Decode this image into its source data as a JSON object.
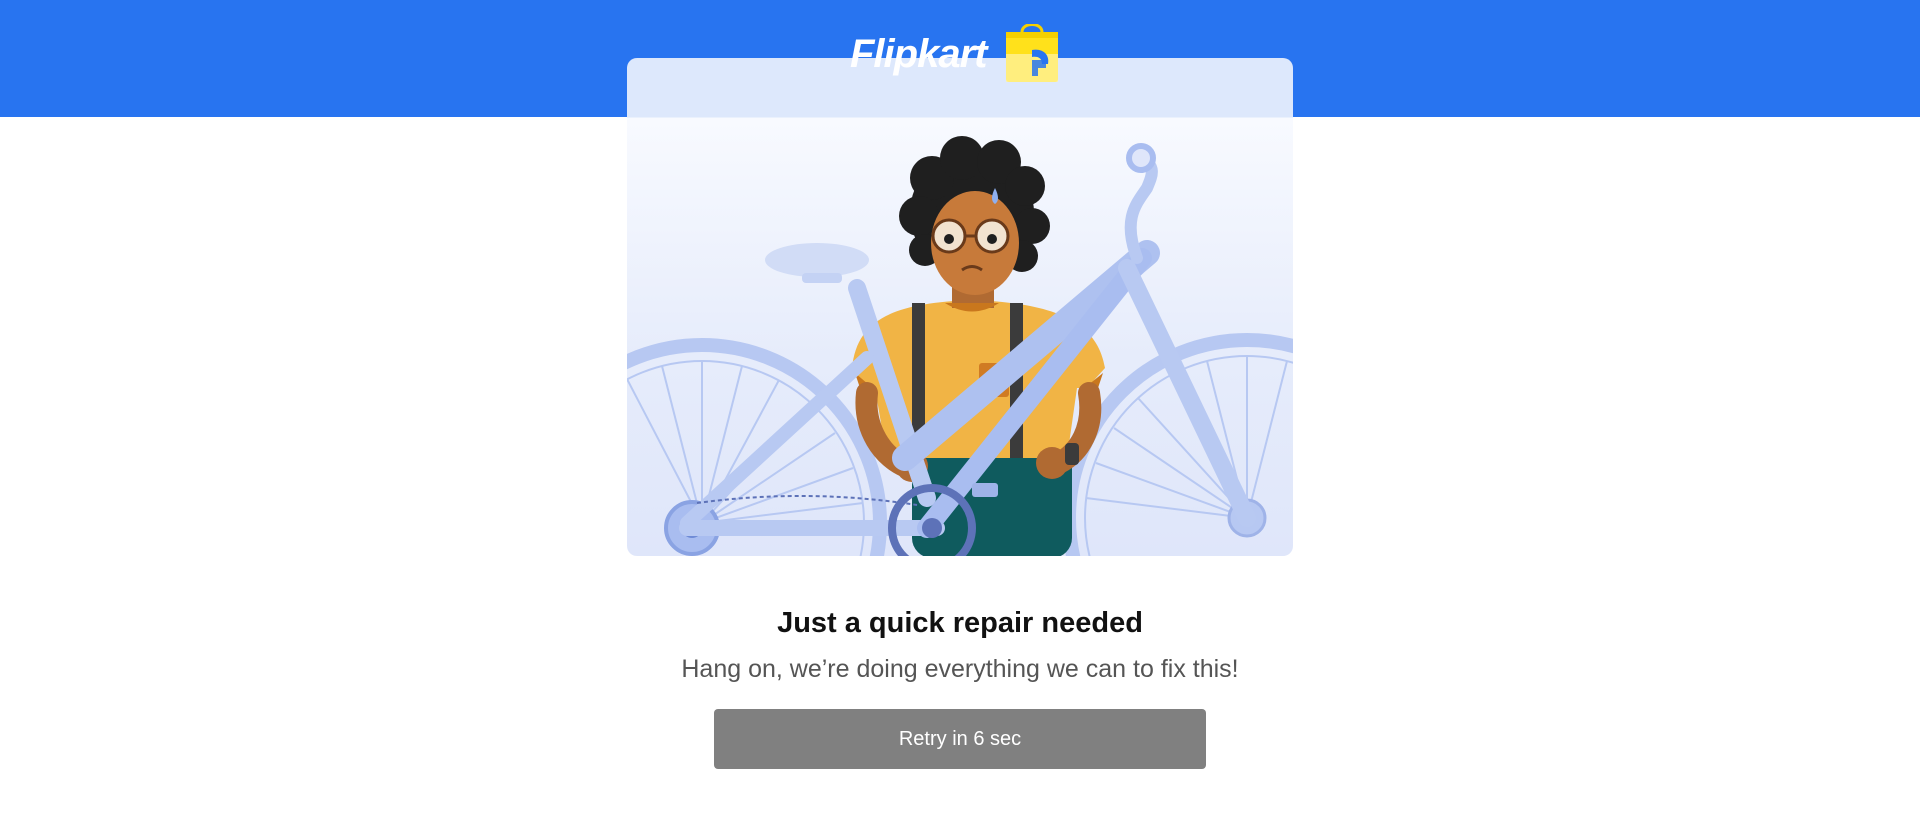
{
  "header": {
    "logo_text": "Flipkart",
    "logo_icon": "flipkart-shopping-bag-icon",
    "background_color": "#2874f0"
  },
  "illustration": {
    "subject": "person-with-bicycle-repair-illustration"
  },
  "message": {
    "title": "Just a quick repair needed",
    "subtitle": "Hang on, we’re doing everything we can to fix this!"
  },
  "retry_button": {
    "label": "Retry in 6 sec",
    "color": "#808080"
  }
}
